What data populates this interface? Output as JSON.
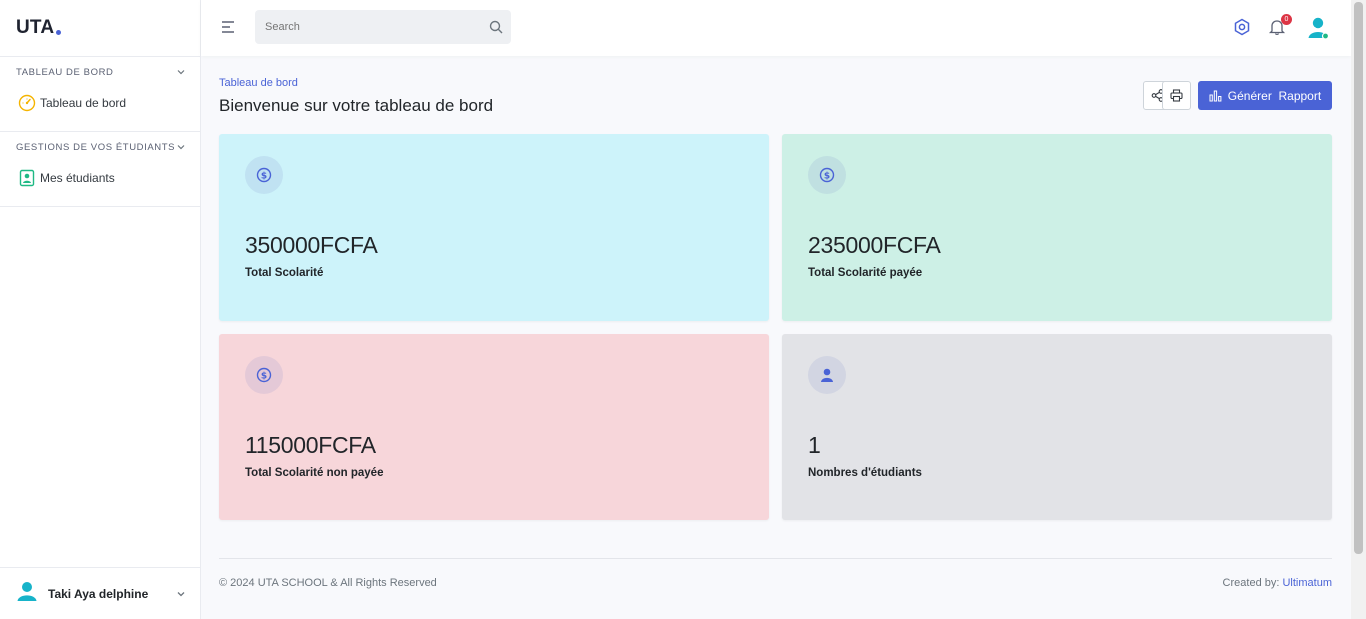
{
  "brand": {
    "name": "UTA"
  },
  "sidebar": {
    "sections": [
      {
        "title": "TABLEAU DE BORD",
        "items": [
          {
            "label": "Tableau de bord",
            "icon": "speedometer-icon"
          }
        ]
      },
      {
        "title": "GESTIONS DE VOS ÉTUDIANTS",
        "items": [
          {
            "label": "Mes étudiants",
            "icon": "student-badge-icon"
          }
        ]
      }
    ],
    "user": {
      "name": "Taki Aya delphine"
    }
  },
  "topbar": {
    "search_placeholder": "Search",
    "notifications_count": "0",
    "colors": {
      "accent": "#4a63d6",
      "badge": "#dc3545",
      "avatar": "#17b3c9"
    }
  },
  "main": {
    "breadcrumb": "Tableau de bord",
    "title": "Bienvenue sur votre tableau de bord",
    "generate_button": "Générer  Rapport",
    "cards": [
      {
        "value": "350000",
        "unit": "FCFA",
        "label": "Total Scolarité",
        "color": "#cdf3fa",
        "icon": "dollar-coin-icon"
      },
      {
        "value": "235000",
        "unit": "FCFA",
        "label": "Total Scolarité payée",
        "color": "#cdf0e6",
        "icon": "dollar-coin-icon"
      },
      {
        "value": "115000",
        "unit": "FCFA",
        "label": "Total Scolarité non payée",
        "color": "#f7d6da",
        "icon": "dollar-coin-icon"
      },
      {
        "value": "1",
        "unit": "",
        "label": "Nombres d'étudiants",
        "color": "#e2e3e7",
        "icon": "user-icon"
      }
    ]
  },
  "footer": {
    "copyright": "© 2024 UTA SCHOOL & All Rights Reserved",
    "created_by_label": "Created by:",
    "created_by_link": "Ultimatum"
  }
}
